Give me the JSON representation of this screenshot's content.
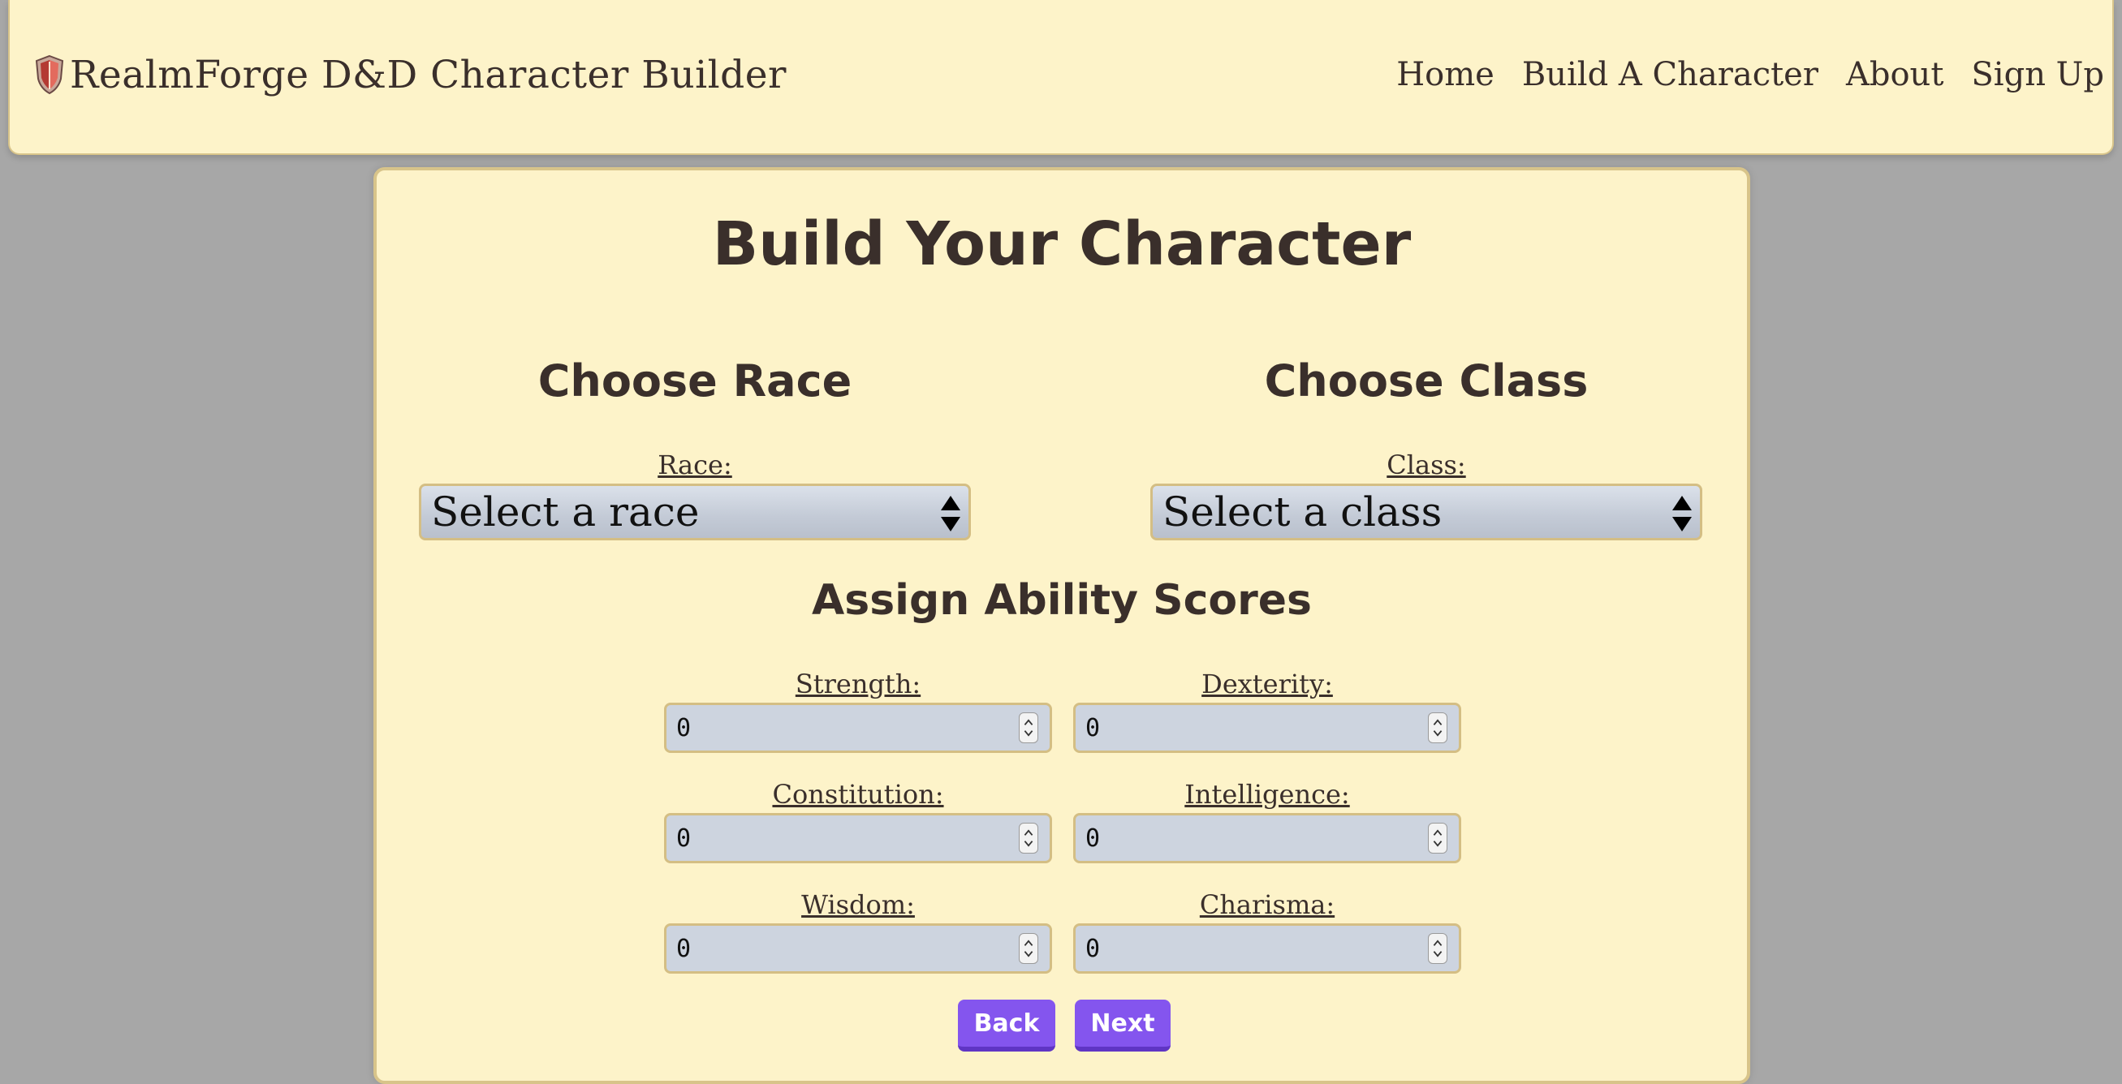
{
  "nav": {
    "brand": "RealmForge D&D Character Builder",
    "links": [
      "Home",
      "Build A Character",
      "About",
      "Sign Up"
    ]
  },
  "main": {
    "title": "Build Your Character",
    "race": {
      "heading": "Choose Race",
      "label": "Race:",
      "selected": "Select a race"
    },
    "class": {
      "heading": "Choose Class",
      "label": "Class:",
      "selected": "Select a class"
    },
    "abilities": {
      "heading": "Assign Ability Scores",
      "fields": [
        {
          "label": "Strength:",
          "value": "0"
        },
        {
          "label": "Dexterity:",
          "value": "0"
        },
        {
          "label": "Constitution:",
          "value": "0"
        },
        {
          "label": "Intelligence:",
          "value": "0"
        },
        {
          "label": "Wisdom:",
          "value": "0"
        },
        {
          "label": "Charisma:",
          "value": "0"
        }
      ]
    },
    "buttons": {
      "back": "Back",
      "next": "Next"
    }
  },
  "colors": {
    "page_background": "#a7a7a7",
    "panel_background": "#fdf3c9",
    "panel_border": "#d8c48a",
    "text": "#3a2f2b",
    "button": "#8455ee"
  },
  "icons": {
    "brand": "shield-icon",
    "select": "up-down-arrows-icon",
    "spinner": "spinner-arrows-icon"
  }
}
